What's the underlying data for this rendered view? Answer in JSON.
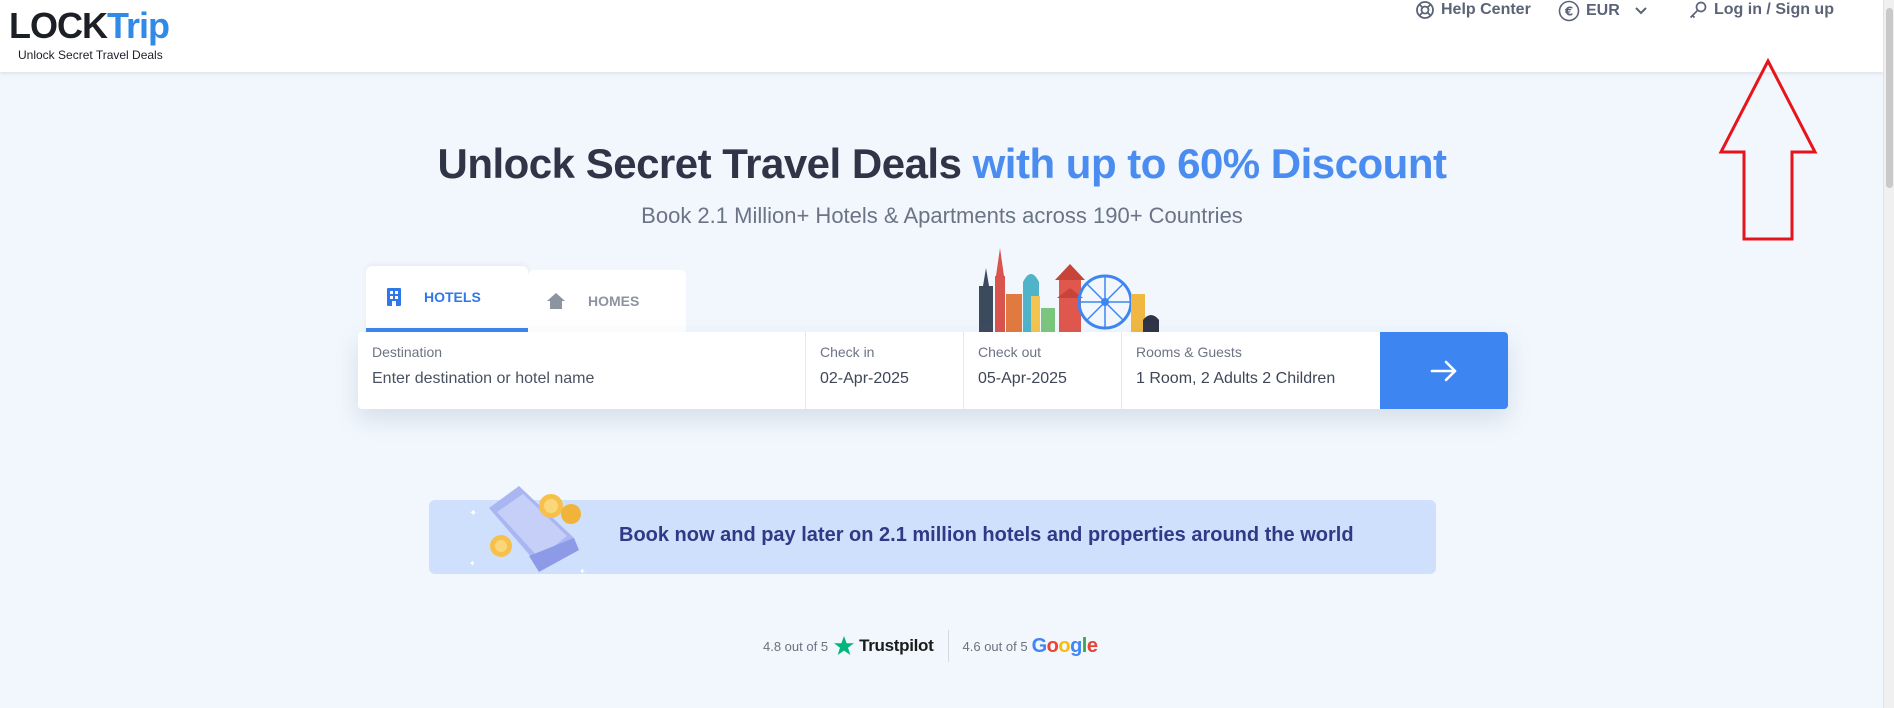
{
  "header": {
    "logo_lock": "LOCK",
    "logo_trip": "Trip",
    "tagline": "Unlock Secret Travel Deals",
    "help_label": "Help Center",
    "currency_label": "EUR",
    "login_label": "Log in / Sign up"
  },
  "hero": {
    "title_main": "Unlock Secret Travel Deals",
    "title_accent": "with up to 60% Discount",
    "subtitle": "Book 2.1 Million+ Hotels & Apartments across 190+ Countries"
  },
  "tabs": [
    {
      "label": "HOTELS",
      "active": true
    },
    {
      "label": "HOMES",
      "active": false
    }
  ],
  "search": {
    "destination_label": "Destination",
    "destination_placeholder": "Enter destination or hotel name",
    "checkin_label": "Check in",
    "checkin_value": "02-Apr-2025",
    "checkout_label": "Check out",
    "checkout_value": "05-Apr-2025",
    "rooms_label": "Rooms & Guests",
    "rooms_value": "1 Room, 2 Adults 2 Children"
  },
  "promo": {
    "text": "Book now and pay later on 2.1 million hotels and properties around the world"
  },
  "ratings": {
    "trustpilot_score": "4.8 out of 5",
    "trustpilot_name": "Trustpilot",
    "google_score": "4.6 out of 5",
    "google_name": "Google"
  },
  "colors": {
    "accent": "#3d86f1",
    "page_bg": "#f1f7fd",
    "promo_bg": "#cfe0fc",
    "annotation": "#e8141c"
  }
}
